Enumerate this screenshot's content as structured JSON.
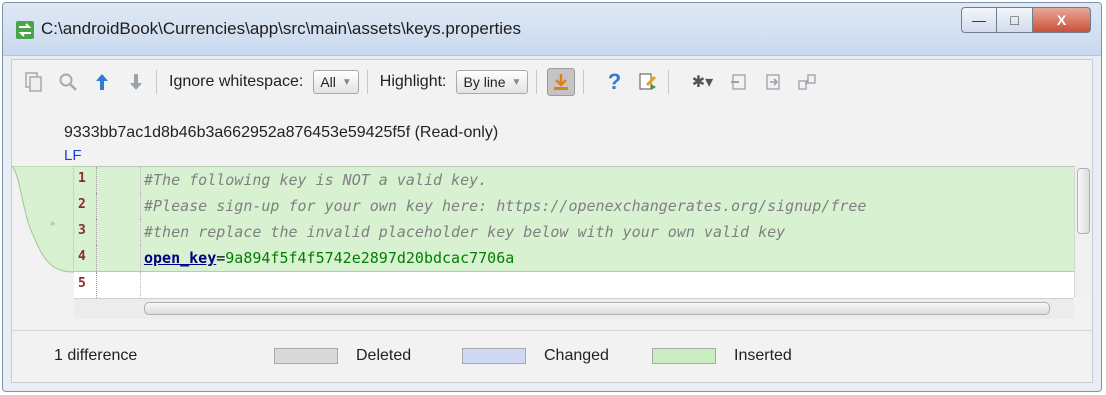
{
  "window": {
    "title": "C:\\androidBook\\Currencies\\app\\src\\main\\assets\\keys.properties",
    "controls": {
      "minimize": "—",
      "maximize": "□",
      "close": "X"
    }
  },
  "toolbar": {
    "icons": [
      "copy-icon",
      "find-icon",
      "previous-difference-icon",
      "next-difference-icon"
    ],
    "ignore_whitespace_label": "Ignore whitespace:",
    "ignore_whitespace_value": "All",
    "highlight_label": "Highlight:",
    "highlight_value": "By line",
    "right_icons": [
      "apply-changes-icon",
      "help-icon",
      "edit-source-icon",
      "settings-icon",
      "collapse-icon",
      "expand-icon",
      "sync-scroll-icon"
    ],
    "help_glyph": "?",
    "settings_glyph": "✱▾"
  },
  "file": {
    "revision": "9333bb7ac1d8b46b3a662952a876453e59425f5f (Read-only)",
    "line_ending": "LF"
  },
  "editor": {
    "lines": [
      {
        "num": "1",
        "type": "inserted",
        "kind": "comment",
        "text": "#The following key is NOT a valid key."
      },
      {
        "num": "2",
        "type": "inserted",
        "kind": "comment",
        "text": "#Please sign-up for your own key here: https://openexchangerates.org/signup/free"
      },
      {
        "num": "3",
        "type": "inserted",
        "kind": "comment",
        "text": "#then replace the invalid placeholder key below with your own valid key"
      },
      {
        "num": "4",
        "type": "inserted",
        "kind": "property",
        "key": "open_key",
        "eq": "=",
        "value": "9a894f5f4f5742e2897d20bdcac7706a"
      },
      {
        "num": "5",
        "type": "normal",
        "kind": "empty",
        "text": ""
      }
    ]
  },
  "legend": {
    "summary": "1 difference",
    "items": [
      {
        "label": "Deleted",
        "color": "#d9d9d9"
      },
      {
        "label": "Changed",
        "color": "#cfd9f6"
      },
      {
        "label": "Inserted",
        "color": "#c9edc0"
      }
    ]
  },
  "colors": {
    "inserted_bg": "#d8f1d1",
    "comment": "#808080",
    "key": "#000080",
    "value": "#008000",
    "line_ending": "#1a3fd6"
  }
}
